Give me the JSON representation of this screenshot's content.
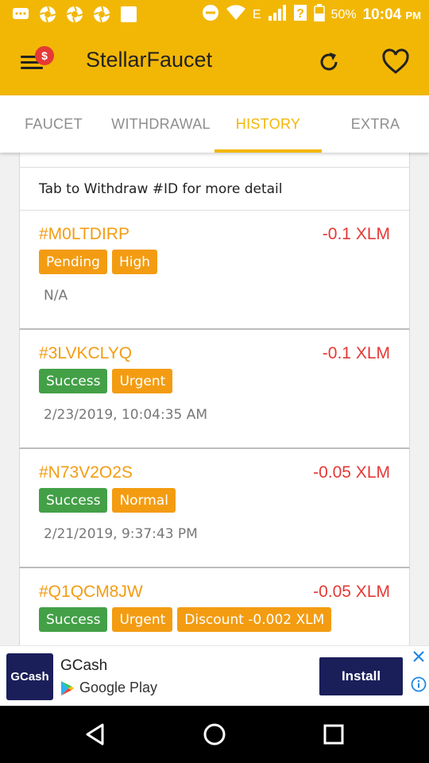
{
  "status_bar": {
    "battery": "50%",
    "time": "10:04",
    "ampm": "PM",
    "network": "E"
  },
  "app_bar": {
    "title": "StellarFaucet",
    "badge": "$"
  },
  "tabs": [
    {
      "label": "FAUCET",
      "active": false
    },
    {
      "label": "WITHDRAWAL",
      "active": false
    },
    {
      "label": "HISTORY",
      "active": true
    },
    {
      "label": "EXTRA",
      "active": false
    }
  ],
  "history": {
    "info": "Tab to Withdraw #ID for more detail",
    "items": [
      {
        "id": "#M0LTDIRP",
        "amount": "-0.1 XLM",
        "tags": [
          "Pending",
          "High"
        ],
        "date": "N/A"
      },
      {
        "id": "#3LVKCLYQ",
        "amount": "-0.1 XLM",
        "tags": [
          "Success",
          "Urgent"
        ],
        "date": "2/23/2019, 10:04:35 AM"
      },
      {
        "id": "#N73V2O2S",
        "amount": "-0.05 XLM",
        "tags": [
          "Success",
          "Normal"
        ],
        "date": "2/21/2019, 9:37:43 PM"
      },
      {
        "id": "#Q1QCM8JW",
        "amount": "-0.05 XLM",
        "tags": [
          "Success",
          "Urgent",
          "Discount -0.002 XLM"
        ],
        "date": ""
      }
    ]
  },
  "ad": {
    "logo_text": "GCash",
    "app_name": "GCash",
    "store": "Google Play",
    "install_label": "Install"
  },
  "colors": {
    "primary": "#f2b705",
    "id_orange": "#f39c12",
    "amount_red": "#e53935",
    "success_green": "#43a047",
    "ad_navy": "#1a1f5a"
  }
}
